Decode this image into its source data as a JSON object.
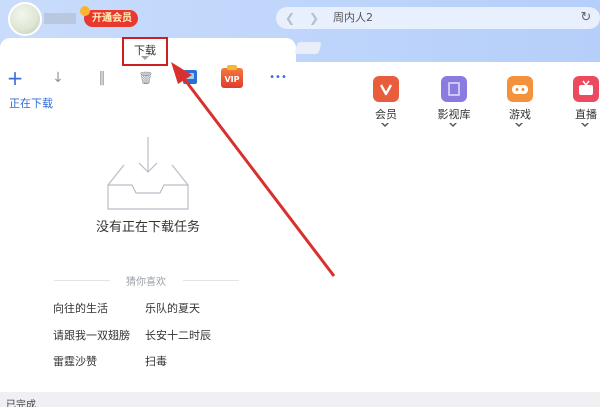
{
  "header": {
    "vip_label": "开通会员"
  },
  "address": {
    "text": "周内人2",
    "back_icon": "chevron-left-icon",
    "forward_icon": "chevron-right-icon",
    "refresh_icon": "refresh-icon"
  },
  "tab": {
    "download_label": "下载"
  },
  "toolbar": {
    "add_icon": "+",
    "download_icon": "↓",
    "pause_icon": "‖",
    "delete_icon": "🗑",
    "more_icon": "•••",
    "vip_icon_label": "VIP"
  },
  "downloads": {
    "section_label": "正在下载",
    "empty_message": "没有正在下载任务",
    "guess_title": "猜你喜欢",
    "recommendations": [
      "向往的生活",
      "乐队的夏天",
      "请跟我一双翅膀",
      "长安十二时辰",
      "雷霆沙赞",
      "扫毒"
    ]
  },
  "apps": [
    {
      "label": "会员",
      "icon": "vip-heart-icon",
      "color": "#e95d3c"
    },
    {
      "label": "影视库",
      "icon": "film-icon",
      "color": "#8a7be0"
    },
    {
      "label": "游戏",
      "icon": "gamepad-icon",
      "color": "#f3923a"
    },
    {
      "label": "直播",
      "icon": "tv-icon",
      "color": "#ec4a5e"
    }
  ],
  "footer": {
    "label": "已完成"
  },
  "colors": {
    "accent": "#2f6bd8",
    "highlight": "#cc1f1f",
    "header_bg": "#c0d6fb"
  }
}
